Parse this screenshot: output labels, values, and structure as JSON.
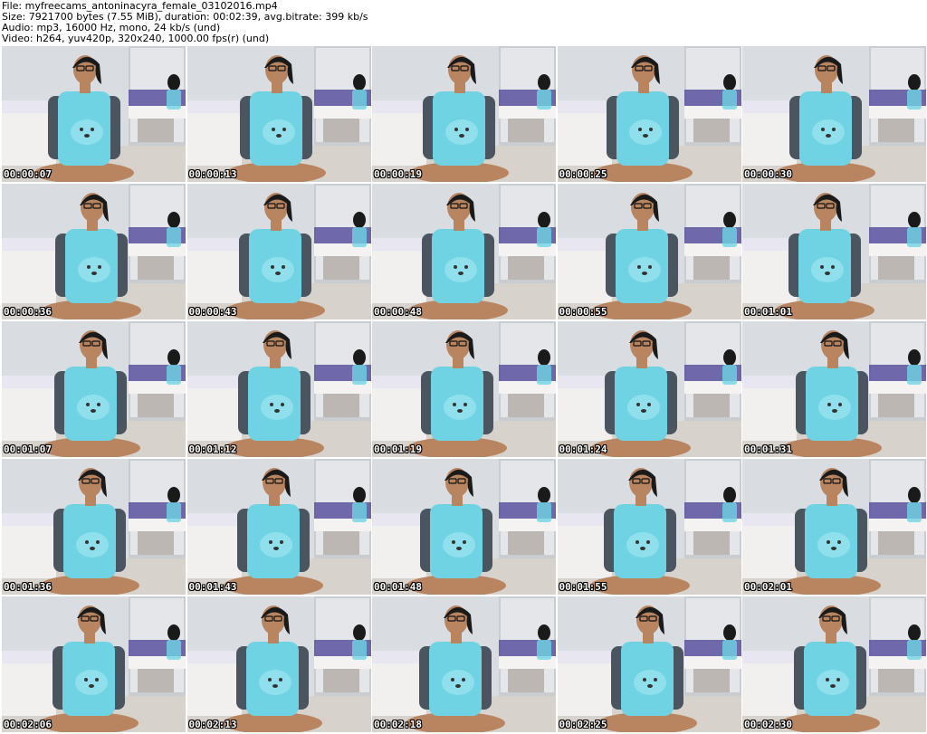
{
  "info": {
    "file": "File: myfreecams_antoninacyra_female_03102016.mp4",
    "size": "Size: 7921700 bytes (7.55 MiB), duration: 00:02:39, avg.bitrate: 399 kb/s",
    "audio": "Audio: mp3, 16000 Hz, mono, 24 kb/s (und)",
    "video": "Video: h264, yuv420p, 320x240, 1000.00 fps(r) (und)"
  },
  "grid": {
    "columns": 5,
    "rows": 5
  },
  "timestamps": [
    "00:00:07",
    "00:00:13",
    "00:00:19",
    "00:00:25",
    "00:00:30",
    "00:00:36",
    "00:00:43",
    "00:00:48",
    "00:00:55",
    "00:01:01",
    "00:01:07",
    "00:01:12",
    "00:01:19",
    "00:01:24",
    "00:01:31",
    "00:01:36",
    "00:01:43",
    "00:01:48",
    "00:01:55",
    "00:02:01",
    "00:02:06",
    "00:02:13",
    "00:02:18",
    "00:02:25",
    "00:02:30"
  ],
  "colors": {
    "wall": "#d9dde2",
    "shirt_body": "#6fd3e3",
    "shirt_sleeve": "#4b5560",
    "skin": "#b88560",
    "hair": "#1a1a1a",
    "bed": "#f2f0ee",
    "stripe": "#5a52a0",
    "floor": "#d8d2cc"
  }
}
